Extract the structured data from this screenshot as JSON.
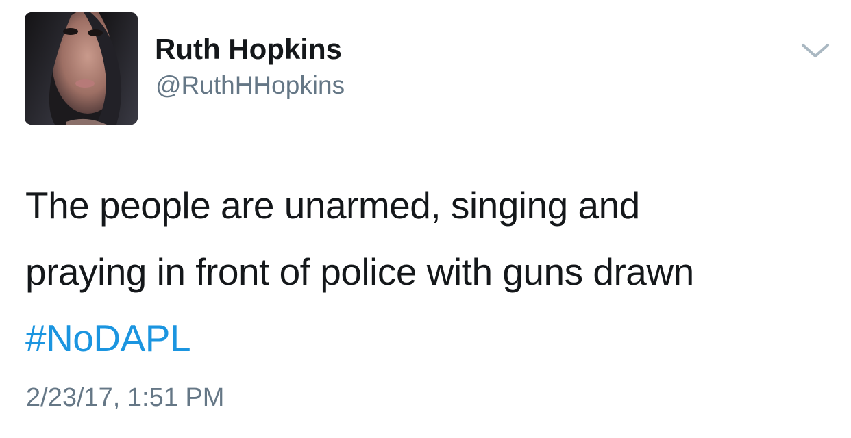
{
  "tweet": {
    "author": {
      "display_name": "Ruth Hopkins",
      "handle": "@RuthHHopkins"
    },
    "text_lines": [
      "The people are unarmed, singing and",
      "praying in front of police with guns drawn"
    ],
    "hashtag": "#NoDAPL",
    "timestamp": "2/23/17, 1:51 PM"
  },
  "icons": {
    "avatar": "profile-photo",
    "menu": "chevron-down-icon"
  },
  "colors": {
    "text": "#14171a",
    "secondary_text": "#657786",
    "link": "#1b95e0",
    "caret": "#aab8c2",
    "background": "#ffffff"
  }
}
